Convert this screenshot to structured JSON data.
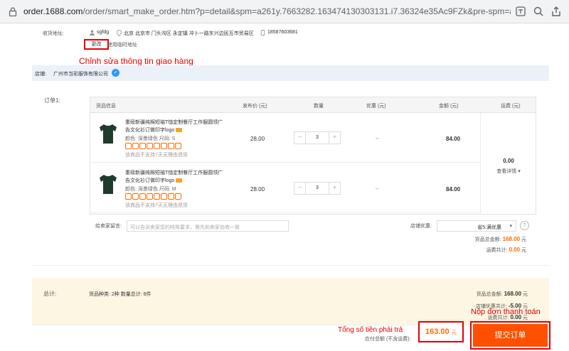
{
  "browser": {
    "url_main": "order.1688.com",
    "url_rest": "/order/smart_make_order.htm?p=detail&spm=a261y.7663282.163474130303131.i7.36324e35Ac9FZk&pre-spm=a26352.136728..."
  },
  "address": {
    "label": "收货地址:",
    "name": "sgfdg",
    "location": "北京 北京市 门头沟区 永定镇 冲卜一路东兴边民互市贸易区",
    "phone": "18587603681",
    "change_label": "更改",
    "temp_label": "使用临时地址",
    "annotation": "Chỉnh sửa thông tin giao hàng"
  },
  "shop": {
    "label": "店铺:",
    "name": "广州市当彩服饰有限公司"
  },
  "order": {
    "label": "订单1:",
    "headers": {
      "product": "货品信息",
      "price": "发布价 (元)",
      "qty": "数量",
      "discount": "优惠 (元)",
      "amount": "金额 (元)",
      "shipping": "运费 (元)"
    },
    "items": [
      {
        "title": "重磅新疆纯棉短袖T恤定制餐厅工作服圆领广告文化衫订做印字logo",
        "spec": "颜色: 深墨绿色    尺码: S",
        "no_return": "该商品不支持7天无理由退货",
        "price": "28.00",
        "qty": "3",
        "minus": "−",
        "plus": "+",
        "discount": "--",
        "amount": "84.00"
      },
      {
        "title": "重磅新疆纯棉短袖T恤定制餐厅工作服圆领广告文化衫订做印字logo",
        "spec": "颜色: 深墨绿色    尺码: M",
        "no_return": "该商品不支持7天无理由退货",
        "price": "28.00",
        "qty": "3",
        "minus": "−",
        "plus": "+",
        "discount": "--",
        "amount": "84.00"
      }
    ],
    "shipping_value": "0.00",
    "shipping_detail": "查看详情 ▾",
    "note_label": "给卖家留言:",
    "note_placeholder": "可以告诉卖家您的特殊要求，需先和卖家协商一致",
    "shop_coupon_label": "店铺优惠:",
    "shop_coupon_value": "省5:满优惠",
    "goods_total_label": "货品总金额:",
    "goods_total": "168.00",
    "shipping_total_label": "运费共计:",
    "shipping_total": "0.00",
    "unit": "元"
  },
  "summary": {
    "label": "总计:",
    "meta": "货品种类: 2种   数量总计: 6件",
    "goods_total_label": "货品总金额:",
    "goods_total": "168.00",
    "shop_discount_label": "店铺优惠共计:",
    "shop_discount": "-5.00",
    "shipping_label": "运费共计:",
    "shipping": "0.00",
    "unit": "元"
  },
  "pay": {
    "total": "163.00",
    "unit": "元",
    "hint": "应付总额 (不含运费):",
    "total_annotation": "Tổng số tiền phải trả",
    "submit_label": "提交订单",
    "submit_annotation": "Nộp đơn thanh toán"
  },
  "colors": {
    "accent": "#ff5000",
    "highlight": "#e60000",
    "shop_bar": "#eaf1f8",
    "total_bg": "#fdf6e3"
  }
}
